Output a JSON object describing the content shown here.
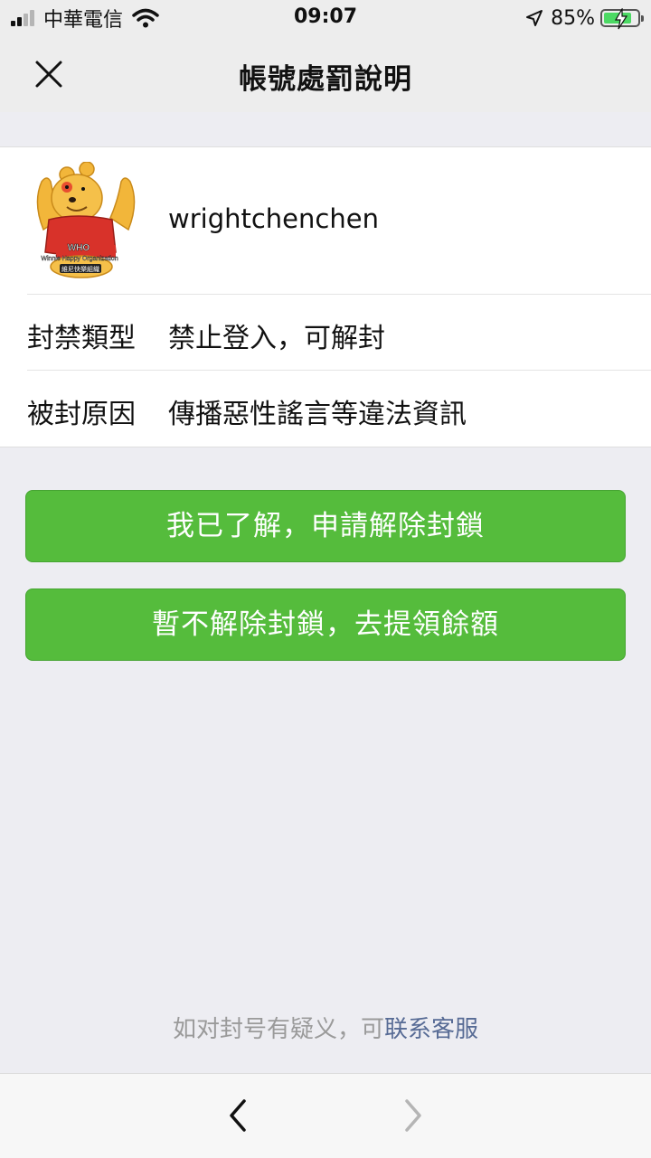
{
  "status_bar": {
    "carrier": "中華電信",
    "time": "09:07",
    "battery": "85%",
    "battery_level": 0.85
  },
  "nav": {
    "title": "帳號處罰說明",
    "close_icon": "close-icon"
  },
  "account": {
    "username": "wrightchenchen",
    "avatar_text": [
      "WHO",
      "Winnie Happy Organization",
      "維尼快樂組織"
    ]
  },
  "rows": [
    {
      "label": "封禁類型",
      "value": "禁止登入，可解封"
    },
    {
      "label": "被封原因",
      "value": "傳播惡性謠言等違法資訊"
    }
  ],
  "buttons": {
    "unblock": "我已了解，申請解除封鎖",
    "withdraw": "暫不解除封鎖，去提領餘額"
  },
  "footer": {
    "prefix": "如对封号有疑义，可",
    "link": "联系客服"
  },
  "toolbar": {
    "back_icon": "chevron-left-icon",
    "forward_icon": "chevron-right-icon"
  },
  "colors": {
    "primary_button": "#55bc3c",
    "link": "#576b95",
    "battery_fill": "#4cd964"
  }
}
